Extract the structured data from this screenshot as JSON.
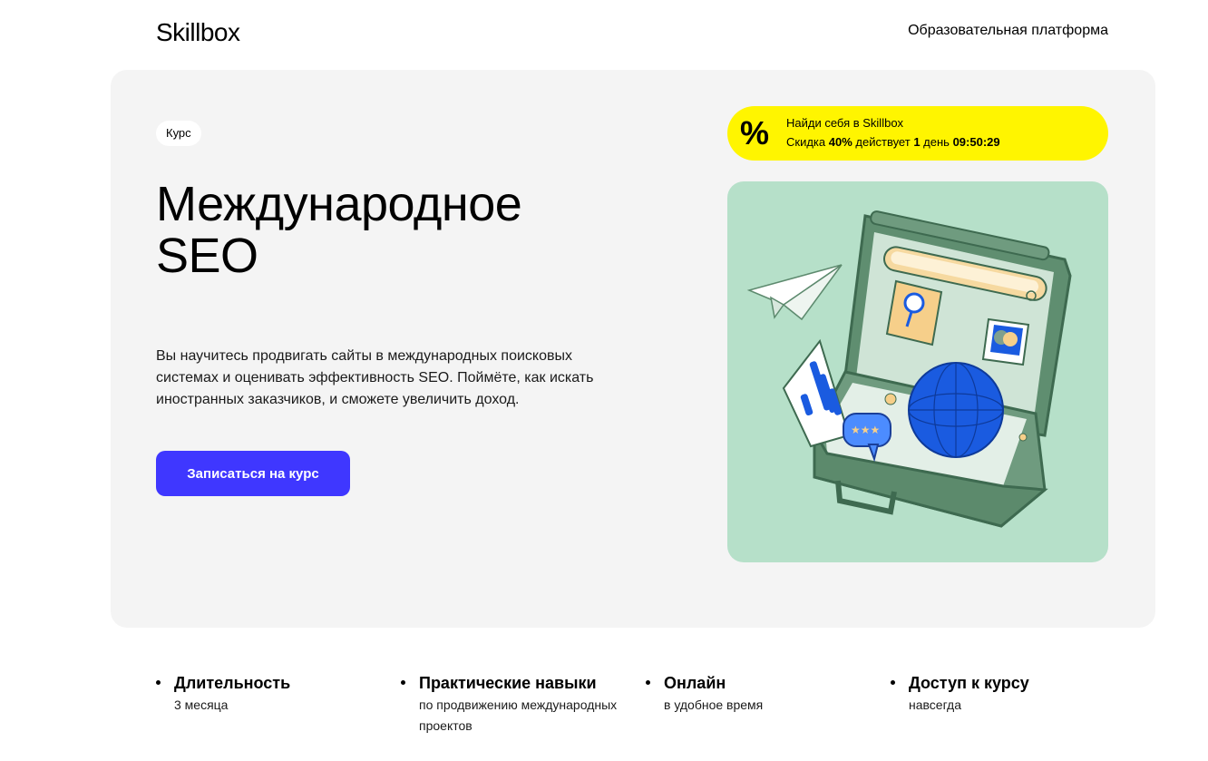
{
  "header": {
    "logo": "Skillbox",
    "nav_text": "Образовательная платформа"
  },
  "hero": {
    "tag": "Курс",
    "title_line1": "Международное",
    "title_line2": "SEO",
    "description": "Вы научитесь продвигать сайты в международных поисковых системах и оценивать эффективность SEO. Поймёте, как искать иностранных заказчиков, и сможете увеличить доход.",
    "cta_label": "Записаться на курс"
  },
  "promo": {
    "icon": "percent-icon",
    "icon_glyph": "%",
    "title": "Найди себя в Skillbox",
    "prefix": "Скидка",
    "discount": "40%",
    "middle": "действует",
    "days": "1",
    "days_word": "день",
    "timer": "09:50:29",
    "color": "#fff500"
  },
  "illustration": {
    "icon": "briefcase-seo-illustration",
    "background": "#b6e0c9"
  },
  "features": [
    {
      "title": "Длительность",
      "subtitle": "3 месяца"
    },
    {
      "title": "Практические навыки",
      "subtitle": "по продвижению международных проектов"
    },
    {
      "title": "Онлайн",
      "subtitle": "в удобное время"
    },
    {
      "title": "Доступ к курсу",
      "subtitle": "навсегда"
    }
  ],
  "colors": {
    "accent": "#3f37ff",
    "hero_bg": "#f4f4f4"
  }
}
